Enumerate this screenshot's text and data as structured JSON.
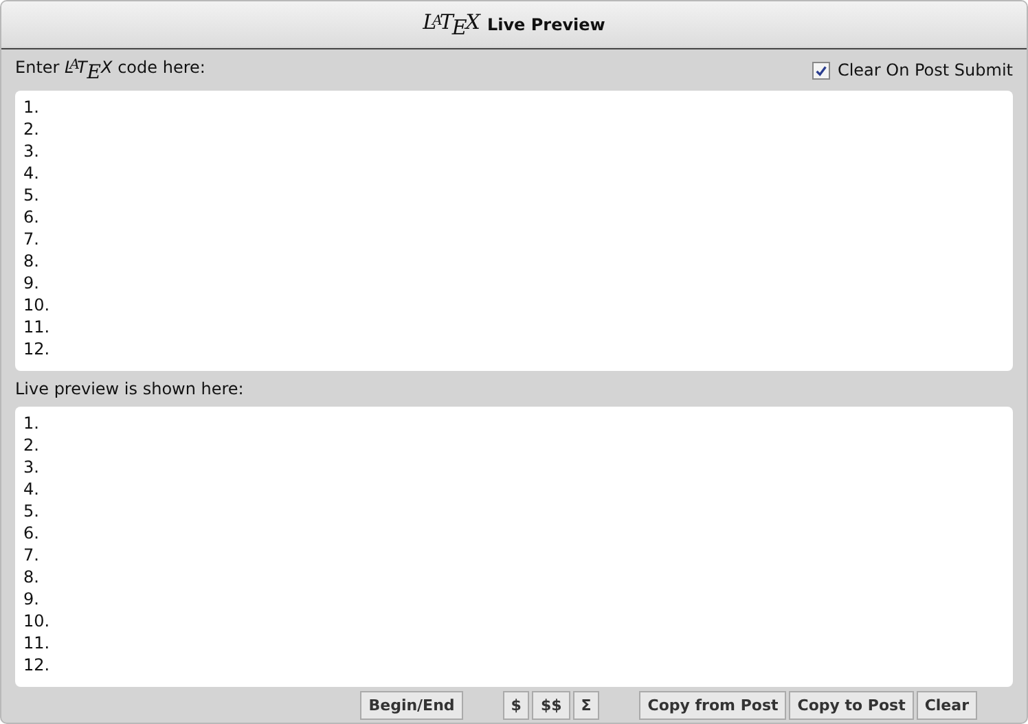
{
  "window": {
    "logo": "L$^{A}$T$_{E}$X",
    "title": "Live Preview"
  },
  "editor": {
    "label": "Enter *L*$^{A}$*T*$_{E}$*X* code here:",
    "clear_on_submit": {
      "label": "Clear On Post Submit",
      "checked": true
    },
    "lines": [
      "1.",
      "2.",
      "3.",
      "4.",
      "5.",
      "6.",
      "7.",
      "8.",
      "9.",
      "10.",
      "11.",
      "12."
    ]
  },
  "preview": {
    "label": "Live preview is shown here:",
    "lines": [
      "1.",
      "2.",
      "3.",
      "4.",
      "5.",
      "6.",
      "7.",
      "8.",
      "9.",
      "10.",
      "11.",
      "12."
    ]
  },
  "toolbar": [
    [
      "Begin/End"
    ],
    [
      "$",
      "$$",
      "Σ"
    ],
    [
      "Copy from Post",
      "Copy to Post",
      "Clear"
    ]
  ]
}
